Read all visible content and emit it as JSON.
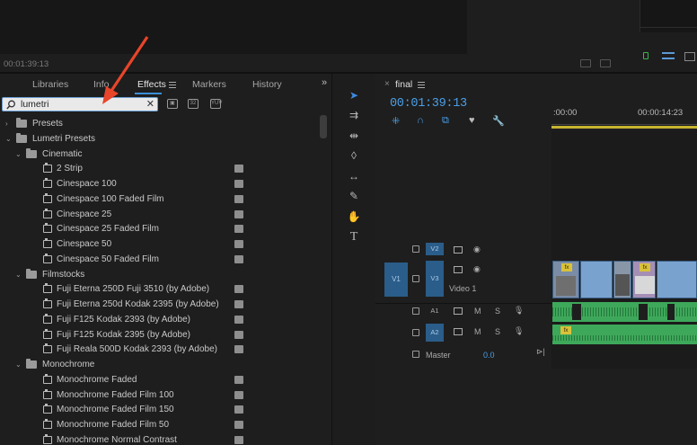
{
  "source_monitor": {
    "timecode": "00:01:39:13"
  },
  "effects_panel": {
    "tabs": [
      {
        "label": "Libraries"
      },
      {
        "label": "Info"
      },
      {
        "label": "Effects"
      },
      {
        "label": "Markers"
      },
      {
        "label": "History"
      }
    ],
    "active_tab": "Effects",
    "search": {
      "value": "lumetri",
      "placeholder": ""
    },
    "tree": [
      {
        "label": "Presets",
        "level": 0,
        "type": "folder"
      },
      {
        "label": "Lumetri Presets",
        "level": 0,
        "type": "folder"
      },
      {
        "label": "Cinematic",
        "level": 1,
        "type": "folder"
      },
      {
        "label": "2 Strip",
        "level": 2,
        "type": "preset"
      },
      {
        "label": "Cinespace 100",
        "level": 2,
        "type": "preset"
      },
      {
        "label": "Cinespace 100 Faded Film",
        "level": 2,
        "type": "preset"
      },
      {
        "label": "Cinespace 25",
        "level": 2,
        "type": "preset"
      },
      {
        "label": "Cinespace 25 Faded Film",
        "level": 2,
        "type": "preset"
      },
      {
        "label": "Cinespace 50",
        "level": 2,
        "type": "preset"
      },
      {
        "label": "Cinespace 50 Faded Film",
        "level": 2,
        "type": "preset"
      },
      {
        "label": "Filmstocks",
        "level": 1,
        "type": "folder"
      },
      {
        "label": "Fuji Eterna 250D Fuji 3510 (by Adobe)",
        "level": 2,
        "type": "preset"
      },
      {
        "label": "Fuji Eterna 250d Kodak 2395 (by Adobe)",
        "level": 2,
        "type": "preset"
      },
      {
        "label": "Fuji F125 Kodak 2393 (by Adobe)",
        "level": 2,
        "type": "preset"
      },
      {
        "label": "Fuji F125 Kodak 2395 (by Adobe)",
        "level": 2,
        "type": "preset"
      },
      {
        "label": "Fuji Reala 500D Kodak 2393 (by Adobe)",
        "level": 2,
        "type": "preset"
      },
      {
        "label": "Monochrome",
        "level": 1,
        "type": "folder"
      },
      {
        "label": "Monochrome Faded",
        "level": 2,
        "type": "preset"
      },
      {
        "label": "Monochrome Faded Film 100",
        "level": 2,
        "type": "preset"
      },
      {
        "label": "Monochrome Faded Film 150",
        "level": 2,
        "type": "preset"
      },
      {
        "label": "Monochrome Faded Film 50",
        "level": 2,
        "type": "preset"
      },
      {
        "label": "Monochrome Normal Contrast",
        "level": 2,
        "type": "preset"
      }
    ]
  },
  "timeline": {
    "sequence_name": "final",
    "timecode": "00:01:39:13",
    "ruler": [
      ":00:00",
      "00:00:14:23"
    ],
    "tracks": {
      "v2": "V2",
      "v1_source": "V1",
      "v1": "V3",
      "video_label": "Video 1",
      "a1": "A1",
      "a2": "A2",
      "m": "M",
      "s": "S",
      "master_label": "Master",
      "master_value": "0.0"
    }
  },
  "colors": {
    "accent_blue": "#3d8be0",
    "timecode_blue": "#4b9fe8",
    "video_clip": "#7aa2cf",
    "audio_clip": "#3ea85a",
    "annotation_arrow": "#e8452a"
  }
}
